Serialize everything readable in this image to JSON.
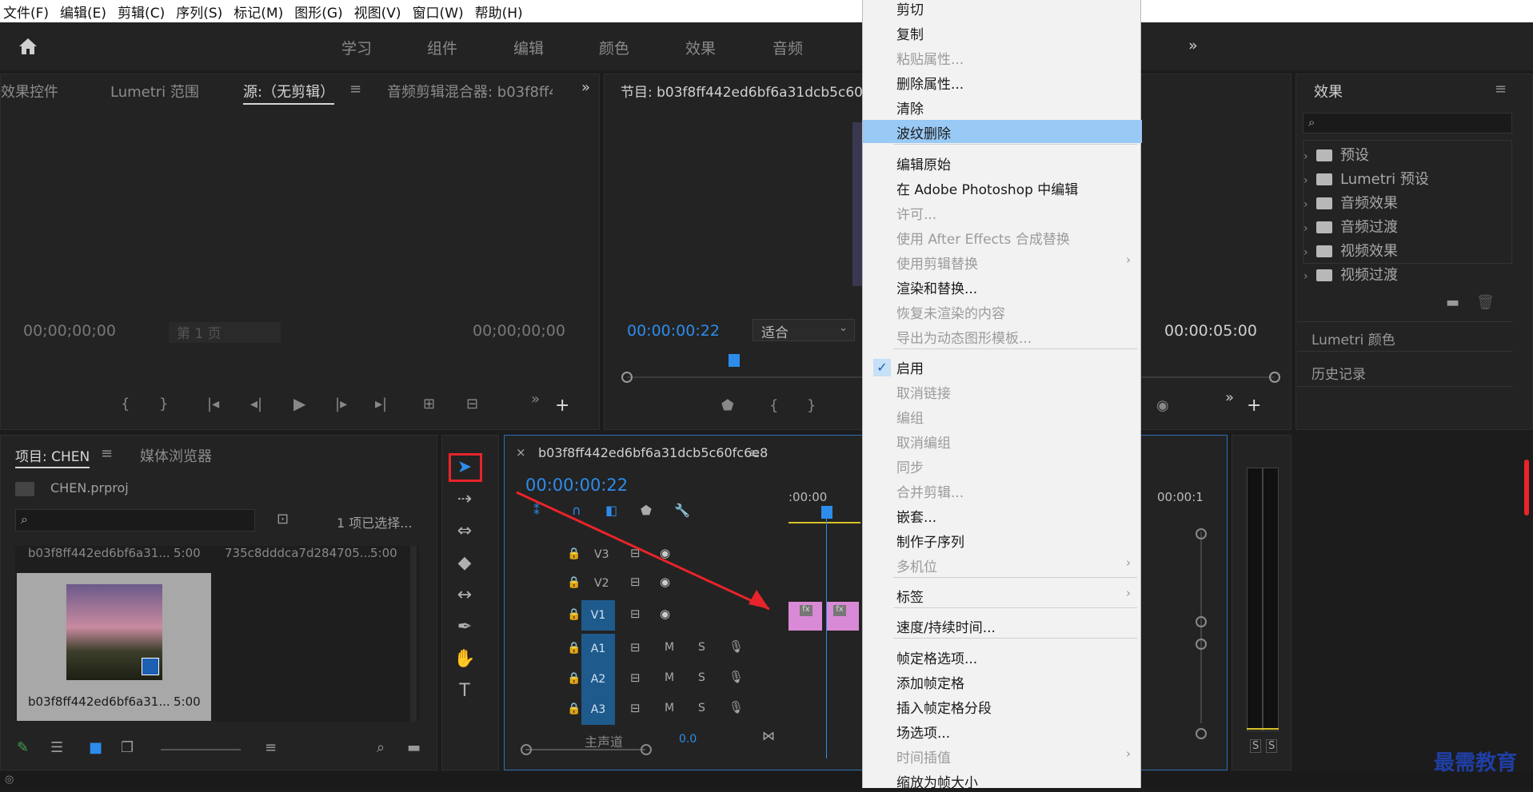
{
  "menubar": {
    "items": [
      "文件(F)",
      "编辑(E)",
      "剪辑(C)",
      "序列(S)",
      "标记(M)",
      "图形(G)",
      "视图(V)",
      "窗口(W)",
      "帮助(H)"
    ]
  },
  "workspaces": [
    "学习",
    "组件",
    "编辑",
    "颜色",
    "效果",
    "音频"
  ],
  "source_panel": {
    "tabs": [
      "效果控件",
      "Lumetri 范围",
      "源:（无剪辑）",
      "音频剪辑混合器: b03f8ff4"
    ],
    "timecode_in": "00;00;00;00",
    "page_dropdown": "第 1 页",
    "timecode_out": "00;00;00;00"
  },
  "program_panel": {
    "title": "节目: b03f8ff442ed6bf6a31dcb5c60fc6e8",
    "timecode": "00:00:00:22",
    "fit_dropdown": "适合",
    "duration": "00:00:05:00"
  },
  "project_panel": {
    "tab_project": "项目: CHEN",
    "tab_media": "媒体浏览器",
    "file": "CHEN.prproj",
    "selected_count": "1 项已选择...",
    "items": [
      {
        "name": "b03f8ff442ed6bf6a31...",
        "duration": "5:00"
      },
      {
        "name": "735c8dddca7d284705...",
        "duration": "5:00"
      },
      {
        "name": "b03f8ff442ed6bf6a31...",
        "duration": "5:00"
      }
    ]
  },
  "timeline": {
    "sequence_name": "b03f8ff442ed6bf6a31dcb5c60fc6e8",
    "timecode": "00:00:00:22",
    "ruler_start": ":00:00",
    "ruler_end": "00:00:1",
    "video_tracks": [
      "V3",
      "V2",
      "V1"
    ],
    "audio_tracks": [
      "A1",
      "A2",
      "A3"
    ],
    "track_m": "M",
    "track_s": "S",
    "master_label": "主声道",
    "master_value": "0.0"
  },
  "context_menu": {
    "items": [
      {
        "label": "剪切",
        "enabled": true
      },
      {
        "label": "复制",
        "enabled": true
      },
      {
        "label": "粘贴属性...",
        "enabled": false
      },
      {
        "label": "删除属性...",
        "enabled": true
      },
      {
        "label": "清除",
        "enabled": true
      },
      {
        "label": "波纹删除",
        "enabled": true,
        "highlighted": true
      },
      {
        "label": "编辑原始",
        "enabled": true
      },
      {
        "label": "在 Adobe Photoshop 中编辑",
        "enabled": true
      },
      {
        "label": "许可...",
        "enabled": false
      },
      {
        "label": "使用 After Effects 合成替换",
        "enabled": false
      },
      {
        "label": "使用剪辑替换",
        "enabled": false,
        "submenu": true
      },
      {
        "label": "渲染和替换...",
        "enabled": true
      },
      {
        "label": "恢复未渲染的内容",
        "enabled": false
      },
      {
        "label": "导出为动态图形模板...",
        "enabled": false
      },
      {
        "label": "启用",
        "enabled": true,
        "checked": true
      },
      {
        "label": "取消链接",
        "enabled": false
      },
      {
        "label": "编组",
        "enabled": false
      },
      {
        "label": "取消编组",
        "enabled": false
      },
      {
        "label": "同步",
        "enabled": false
      },
      {
        "label": "合并剪辑...",
        "enabled": false
      },
      {
        "label": "嵌套...",
        "enabled": true
      },
      {
        "label": "制作子序列",
        "enabled": true
      },
      {
        "label": "多机位",
        "enabled": false,
        "submenu": true
      },
      {
        "label": "标签",
        "enabled": true,
        "submenu": true
      },
      {
        "label": "速度/持续时间...",
        "enabled": true
      },
      {
        "label": "帧定格选项...",
        "enabled": true
      },
      {
        "label": "添加帧定格",
        "enabled": true
      },
      {
        "label": "插入帧定格分段",
        "enabled": true
      },
      {
        "label": "场选项...",
        "enabled": true
      },
      {
        "label": "时间插值",
        "enabled": false,
        "submenu": true
      },
      {
        "label": "缩放为帧大小",
        "enabled": true
      }
    ]
  },
  "effects_panel": {
    "title": "效果",
    "items": [
      "预设",
      "Lumetri 预设",
      "音频效果",
      "音频过渡",
      "视频效果",
      "视频过渡"
    ],
    "lumetri_color": "Lumetri 颜色",
    "history": "历史记录"
  },
  "meter": {
    "s1": "S",
    "s2": "S"
  },
  "watermark": "最需教育",
  "colors": {
    "accent": "#2d8ceb",
    "highlight": "#99c9f5",
    "clip": "#d98ad6",
    "annotation_red": "#e8242a"
  }
}
